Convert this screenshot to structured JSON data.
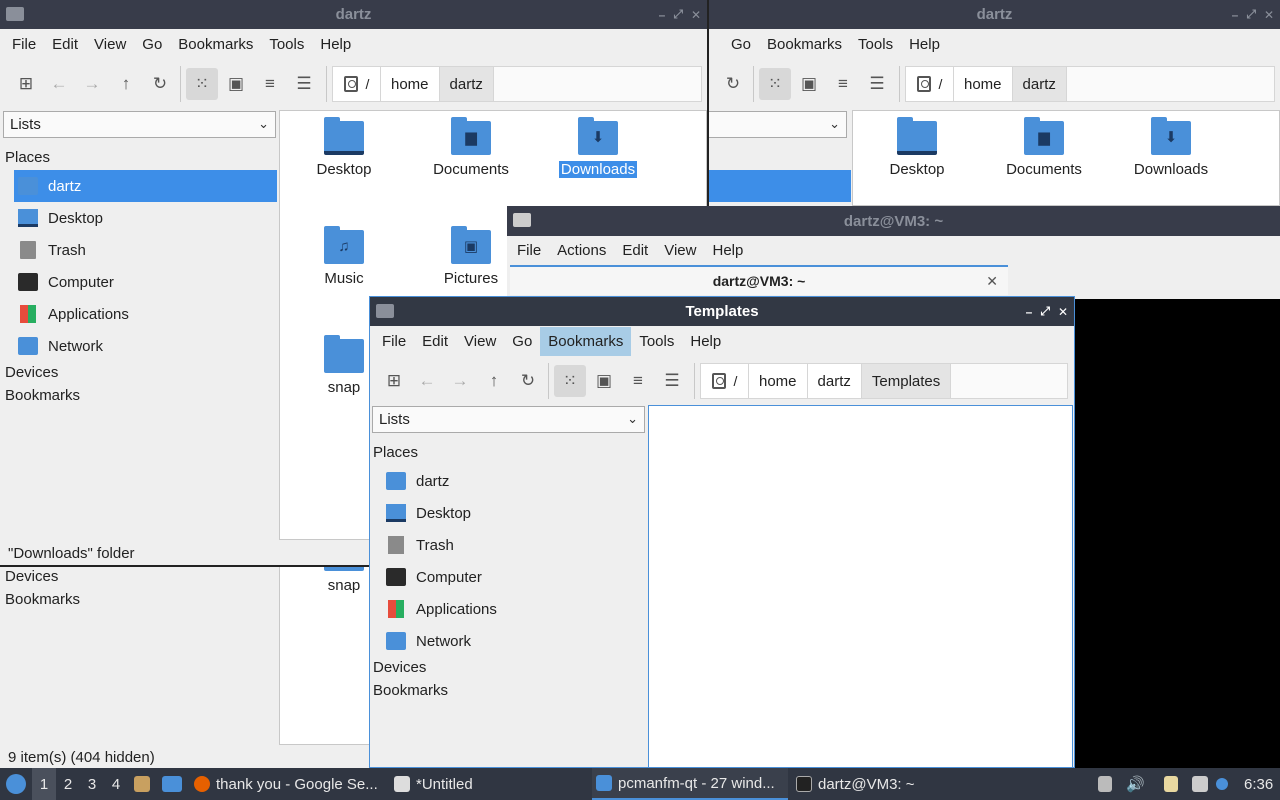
{
  "win_dartz_main": {
    "title": "dartz",
    "menu": [
      "File",
      "Edit",
      "View",
      "Go",
      "Bookmarks",
      "Tools",
      "Help"
    ],
    "path": [
      "home",
      "dartz"
    ],
    "root": "/",
    "combo": "Lists",
    "places_header": "Places",
    "places": [
      "dartz",
      "Desktop",
      "Trash",
      "Computer",
      "Applications",
      "Network"
    ],
    "devices": "Devices",
    "bookmarks": "Bookmarks",
    "files": [
      {
        "name": "Desktop",
        "glyph": ""
      },
      {
        "name": "Documents",
        "glyph": "▆"
      },
      {
        "name": "Downloads",
        "glyph": "⬇"
      },
      {
        "name": "Music",
        "glyph": "♫"
      },
      {
        "name": "Pictures",
        "glyph": "▣"
      },
      {
        "name": "snap",
        "glyph": ""
      }
    ],
    "status": "\"Downloads\" folder"
  },
  "win_dartz_lower": {
    "devices": "Devices",
    "bookmarks": "Bookmarks",
    "file": "snap",
    "status": "9 item(s) (404 hidden)"
  },
  "win_dartz_right": {
    "title": "dartz",
    "menu": [
      "Go",
      "Bookmarks",
      "Tools",
      "Help"
    ],
    "path": [
      "home",
      "dartz"
    ],
    "root": "/",
    "files": [
      "Desktop",
      "Documents",
      "Downloads"
    ]
  },
  "terminal": {
    "title": "dartz@VM3: ~",
    "menu": [
      "File",
      "Actions",
      "Edit",
      "View",
      "Help"
    ],
    "tab": "dartz@VM3: ~"
  },
  "win_templates": {
    "title": "Templates",
    "menu": [
      "File",
      "Edit",
      "View",
      "Go",
      "Bookmarks",
      "Tools",
      "Help"
    ],
    "path": [
      "home",
      "dartz",
      "Templates"
    ],
    "root": "/",
    "combo": "Lists",
    "places_header": "Places",
    "places": [
      "dartz",
      "Desktop",
      "Trash",
      "Computer",
      "Applications",
      "Network"
    ],
    "devices": "Devices",
    "bookmarks": "Bookmarks"
  },
  "taskbar": {
    "workspaces": [
      "1",
      "2",
      "3",
      "4"
    ],
    "tasks": [
      "thank you - Google Se...",
      "*Untitled",
      "pcmanfm-qt - 27 wind...",
      "dartz@VM3: ~"
    ],
    "clock": "6:36"
  }
}
